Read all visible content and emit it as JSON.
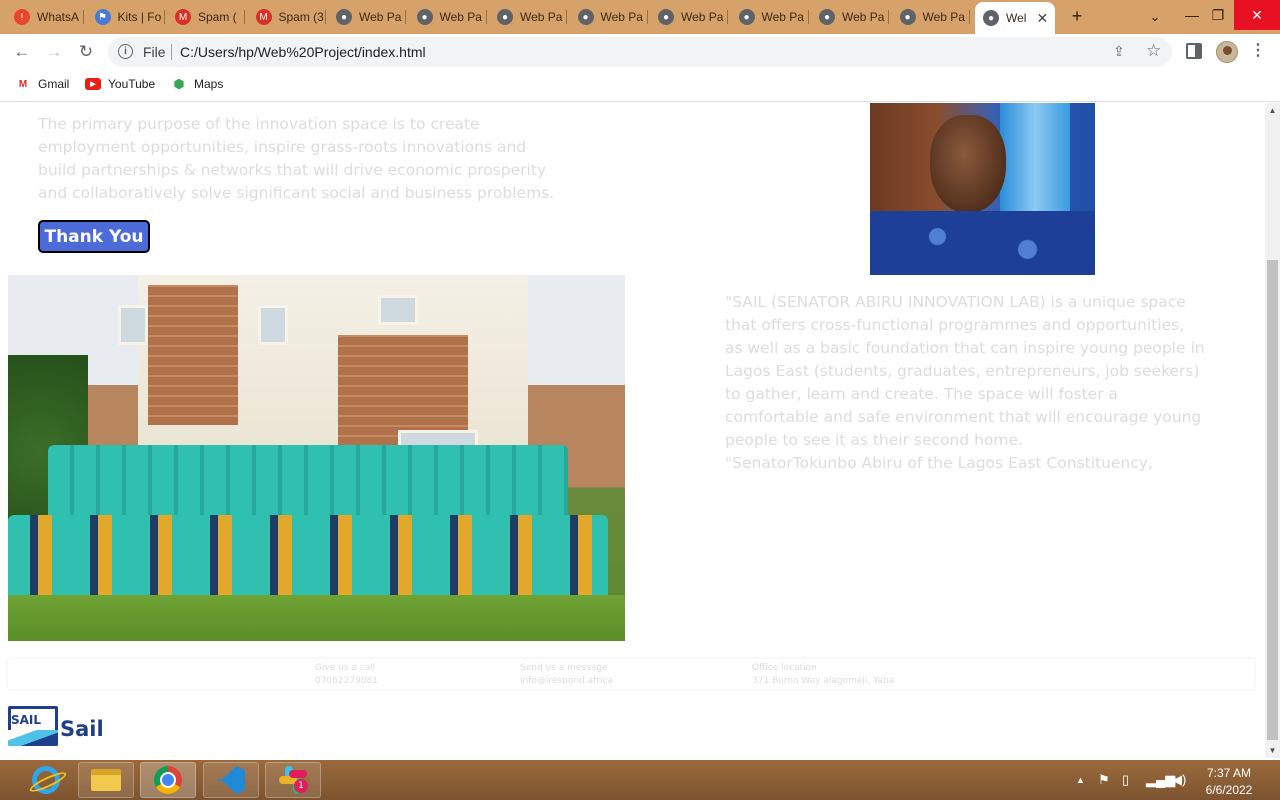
{
  "browser": {
    "tabs": [
      {
        "label": "WhatsA",
        "icon": "whatsapp-alert-icon",
        "color": "#e8452c"
      },
      {
        "label": "Kits | Fo",
        "icon": "flag-icon",
        "color": "#4a7bd4"
      },
      {
        "label": "Spam (",
        "icon": "gmail-icon",
        "color": "#d93025"
      },
      {
        "label": "Spam (3",
        "icon": "gmail-icon",
        "color": "#d93025"
      },
      {
        "label": "Web Pa",
        "icon": "globe-icon",
        "color": "#5f6368"
      },
      {
        "label": "Web Pa",
        "icon": "globe-icon",
        "color": "#5f6368"
      },
      {
        "label": "Web Pa",
        "icon": "globe-icon",
        "color": "#5f6368"
      },
      {
        "label": "Web Pa",
        "icon": "globe-icon",
        "color": "#5f6368"
      },
      {
        "label": "Web Pa",
        "icon": "globe-icon",
        "color": "#5f6368"
      },
      {
        "label": "Web Pa",
        "icon": "globe-icon",
        "color": "#5f6368"
      },
      {
        "label": "Web Pa",
        "icon": "globe-icon",
        "color": "#5f6368"
      },
      {
        "label": "Web Pa",
        "icon": "globe-icon",
        "color": "#5f6368"
      }
    ],
    "active_tab": {
      "label": "Wel",
      "icon": "globe-icon"
    },
    "new_tab_glyph": "+",
    "address": {
      "scheme": "File",
      "url": "C:/Users/hp/Web%20Project/index.html"
    },
    "bookmarks": [
      {
        "label": "Gmail",
        "icon": "gmail-icon"
      },
      {
        "label": "YouTube",
        "icon": "youtube-icon"
      },
      {
        "label": "Maps",
        "icon": "maps-icon"
      }
    ]
  },
  "page": {
    "intro_text": "The primary purpose of the innovation space is to create employment opportunities, inspire grass-roots innovations and build partnerships & networks that will drive economic prosperity and collaboratively solve significant social and business problems.",
    "thank_you_button": "Thank You",
    "quote_text": "\"SAIL (SENATOR ABIRU INNOVATION LAB) is a unique space that offers cross-functional programmes and opportunities, as well as a basic foundation that can inspire young people in Lagos East (students, graduates, entrepreneurs, job seekers) to gather, learn and create. The space will foster a comfortable and safe environment that will encourage young people to see it as their second home.",
    "quote_attribution": "\"SenatorTokunbo Abiru of the Lagos East Constituency,",
    "footer": {
      "call": {
        "label": "Give us a call",
        "value": "07062279081"
      },
      "message": {
        "label": "Send us a message",
        "value": "info@irespond.africa"
      },
      "location": {
        "label": "Office location",
        "value": "371 Borno Way alagomeji, Yaba"
      }
    },
    "logo_mark": "SAIL",
    "logo_text": "Sail",
    "accent_color": "#4c6ad8"
  },
  "taskbar": {
    "apps": [
      "internet-explorer-icon",
      "file-explorer-icon",
      "chrome-icon",
      "vscode-icon",
      "slack-icon"
    ],
    "slack_badge": "1",
    "time": "7:37 AM",
    "date": "6/6/2022"
  }
}
